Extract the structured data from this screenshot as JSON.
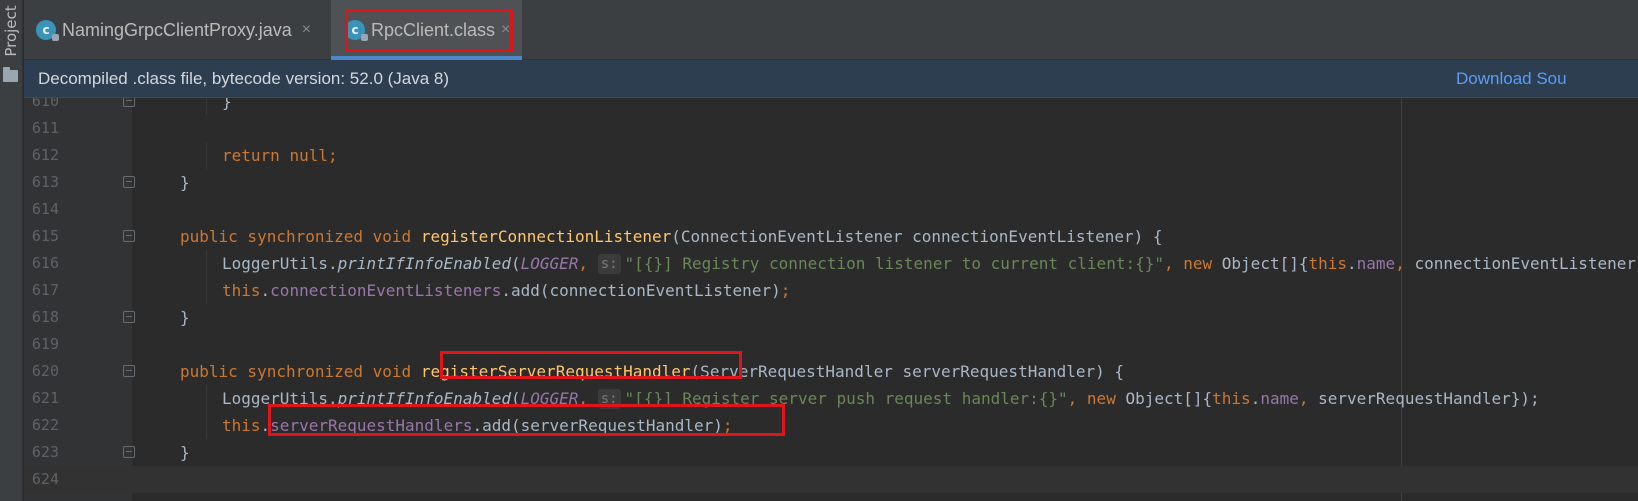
{
  "sidebar": {
    "project_label": "Project"
  },
  "tabs": [
    {
      "label": "NamingGrpcClientProxy.java",
      "icon_text": "c",
      "close": "×",
      "active": false
    },
    {
      "label": "RpcClient.class",
      "icon_text": "c",
      "close": "×",
      "active": true
    }
  ],
  "banner": {
    "text": "Decompiled .class file, bytecode version: 52.0 (Java 8)",
    "link": "Download Sou"
  },
  "editor": {
    "lines": [
      {
        "num": "610",
        "indent": 2,
        "tokens": [
          [
            "p",
            "}"
          ]
        ]
      },
      {
        "num": "611",
        "indent": 0,
        "tokens": []
      },
      {
        "num": "612",
        "indent": 2,
        "tokens": [
          [
            "kw",
            "return "
          ],
          [
            "kw",
            "null"
          ],
          [
            "kw",
            ";"
          ]
        ]
      },
      {
        "num": "613",
        "indent": 1,
        "tokens": [
          [
            "p",
            "}"
          ]
        ]
      },
      {
        "num": "614",
        "indent": 0,
        "tokens": []
      },
      {
        "num": "615",
        "indent": 1,
        "tokens": [
          [
            "kw",
            "public synchronized void "
          ],
          [
            "fn",
            "registerConnectionListener"
          ],
          [
            "p",
            "(ConnectionEventListener connectionEventListener) {"
          ]
        ]
      },
      {
        "num": "616",
        "indent": 2,
        "tokens": [
          [
            "p",
            "LoggerUtils."
          ],
          [
            "it",
            "printIfInfoEnabled"
          ],
          [
            "p",
            "("
          ],
          [
            "fldit",
            "LOGGER"
          ],
          [
            "kw",
            ", "
          ],
          [
            "hint",
            "s:"
          ],
          [
            "st",
            "\"[{}] Registry connection listener to current client:{}\""
          ],
          [
            "kw",
            ", "
          ],
          [
            "kw",
            "new "
          ],
          [
            "p",
            "Object[]{"
          ],
          [
            "kw",
            "this"
          ],
          [
            "p",
            "."
          ],
          [
            "fld",
            "name"
          ],
          [
            "kw",
            ", "
          ],
          [
            "p",
            "connectionEventListener});"
          ]
        ]
      },
      {
        "num": "617",
        "indent": 2,
        "tokens": [
          [
            "kw",
            "this"
          ],
          [
            "p",
            "."
          ],
          [
            "fld",
            "connectionEventListeners"
          ],
          [
            "p",
            ".add(connectionEventListener)"
          ],
          [
            "kw",
            ";"
          ]
        ]
      },
      {
        "num": "618",
        "indent": 1,
        "tokens": [
          [
            "p",
            "}"
          ]
        ]
      },
      {
        "num": "619",
        "indent": 0,
        "tokens": []
      },
      {
        "num": "620",
        "indent": 1,
        "tokens": [
          [
            "kw",
            "public synchronized void "
          ],
          [
            "fn",
            "registerServerRequestHandler"
          ],
          [
            "p",
            "(ServerRequestHandler serverRequestHandler) {"
          ]
        ]
      },
      {
        "num": "621",
        "indent": 2,
        "tokens": [
          [
            "p",
            "LoggerUtils."
          ],
          [
            "it",
            "printIfInfoEnabled"
          ],
          [
            "p",
            "("
          ],
          [
            "fldit",
            "LOGGER"
          ],
          [
            "kw",
            ", "
          ],
          [
            "hint",
            "s:"
          ],
          [
            "st",
            "\"[{}] Register server push request handler:{}\""
          ],
          [
            "kw",
            ", "
          ],
          [
            "kw",
            "new "
          ],
          [
            "p",
            "Object[]{"
          ],
          [
            "kw",
            "this"
          ],
          [
            "p",
            "."
          ],
          [
            "fld",
            "name"
          ],
          [
            "kw",
            ", "
          ],
          [
            "p",
            "serverRequestHandler});"
          ]
        ]
      },
      {
        "num": "622",
        "indent": 2,
        "tokens": [
          [
            "kw",
            "this"
          ],
          [
            "p",
            "."
          ],
          [
            "fld",
            "serverRequestHandlers"
          ],
          [
            "p",
            ".add(serverRequestHandler)"
          ],
          [
            "kw",
            ";"
          ]
        ]
      },
      {
        "num": "623",
        "indent": 1,
        "tokens": [
          [
            "p",
            "}"
          ]
        ]
      },
      {
        "num": "624",
        "indent": 0,
        "tokens": []
      }
    ]
  },
  "colors": {
    "keyword": "#cc7832",
    "method": "#ffc66d",
    "field": "#9876aa",
    "string": "#6a8759",
    "plain": "#a9b7c6",
    "highlight_box": "#e0141b"
  }
}
